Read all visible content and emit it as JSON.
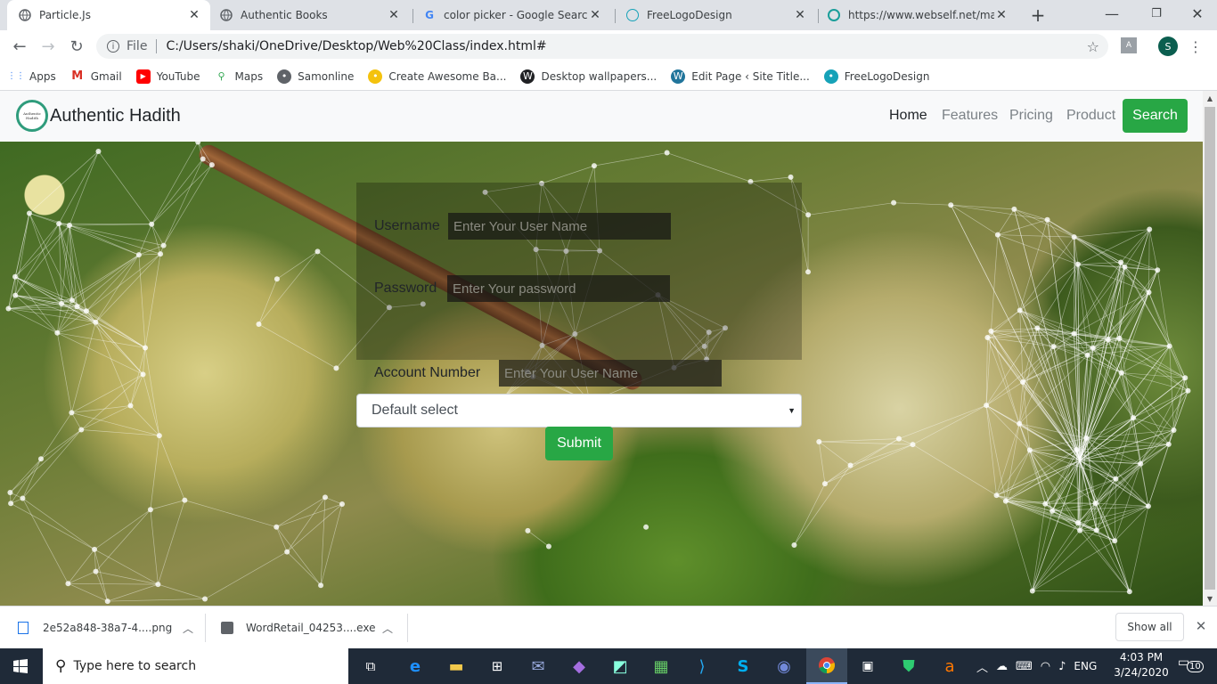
{
  "tabs": [
    {
      "title": "Particle.Js",
      "icon": "globe-icon",
      "active": true
    },
    {
      "title": "Authentic Books",
      "icon": "globe-icon"
    },
    {
      "title": "color picker - Google Search",
      "icon": "google-icon"
    },
    {
      "title": "FreeLogoDesign",
      "icon": "flg-icon"
    },
    {
      "title": "https://www.webself.net/mana",
      "icon": "webself-icon"
    }
  ],
  "toolbar": {
    "security_label": "File",
    "url": "C:/Users/shaki/OneDrive/Desktop/Web%20Class/index.html#",
    "profile_initial": "S"
  },
  "bookmarks": [
    {
      "label": "Apps",
      "icon": "apps-grid-icon",
      "color": "#4285f4"
    },
    {
      "label": "Gmail",
      "icon": "gmail-icon",
      "color": "#d93025"
    },
    {
      "label": "YouTube",
      "icon": "youtube-icon",
      "color": "#ff0000"
    },
    {
      "label": "Maps",
      "icon": "maps-icon",
      "color": "#34a853"
    },
    {
      "label": "Samonline",
      "icon": "globe-icon",
      "color": "#5f6368"
    },
    {
      "label": "Create Awesome Ba...",
      "icon": "smiley-icon",
      "color": "#f4c20d"
    },
    {
      "label": "Desktop wallpapers...",
      "icon": "w-badge-icon",
      "color": "#202124"
    },
    {
      "label": "Edit Page ‹ Site Title...",
      "icon": "wordpress-icon",
      "color": "#21759b"
    },
    {
      "label": "FreeLogoDesign",
      "icon": "flg-icon",
      "color": "#16a2b8"
    }
  ],
  "site": {
    "brand": "Authentic Hadith",
    "logo_text": "Authentic Hadith",
    "nav": [
      "Home",
      "Features",
      "Pricing",
      "Product"
    ],
    "search_button": "Search",
    "accent": "#28a745"
  },
  "form": {
    "username_label": "Username",
    "username_placeholder": "Enter Your User Name",
    "password_label": "Password",
    "password_placeholder": "Enter Your password",
    "account_label": "Account Number",
    "account_placeholder": "Enter Your User Name",
    "select_value": "Default select",
    "submit_label": "Submit"
  },
  "downloads": [
    {
      "name": "2e52a848-38a7-4....png",
      "icon": "image-file-icon"
    },
    {
      "name": "WordRetail_04253....exe",
      "icon": "installer-icon"
    }
  ],
  "downloads_show_all": "Show all",
  "taskbar": {
    "search_placeholder": "Type here to search",
    "time": "4:03 PM",
    "date": "3/24/2020",
    "language": "ENG",
    "notifications": "10"
  }
}
